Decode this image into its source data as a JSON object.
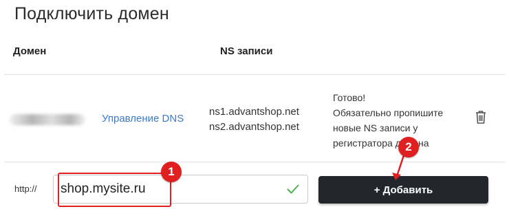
{
  "page": {
    "title": "Подключить домен"
  },
  "table": {
    "headers": {
      "domain": "Домен",
      "ns": "NS записи"
    },
    "row": {
      "dns_link": "Управление DNS",
      "ns_records": [
        "ns1.advantshop.net",
        "ns2.advantshop.net"
      ],
      "status_lines": [
        "Готово!",
        "Обязательно пропишите",
        "новые NS записи у",
        "регистратора домена"
      ],
      "delete_icon": "trash-icon"
    }
  },
  "form": {
    "prefix": "http://",
    "domain_value": "shop.mysite.ru",
    "valid_icon": "check-icon",
    "add_button": "+ Добавить"
  },
  "annotations": {
    "marker_1": "1",
    "marker_2": "2",
    "color": "#e02020"
  },
  "colors": {
    "link": "#3b79c9",
    "button_bg": "#23262d",
    "check": "#4caf50"
  }
}
